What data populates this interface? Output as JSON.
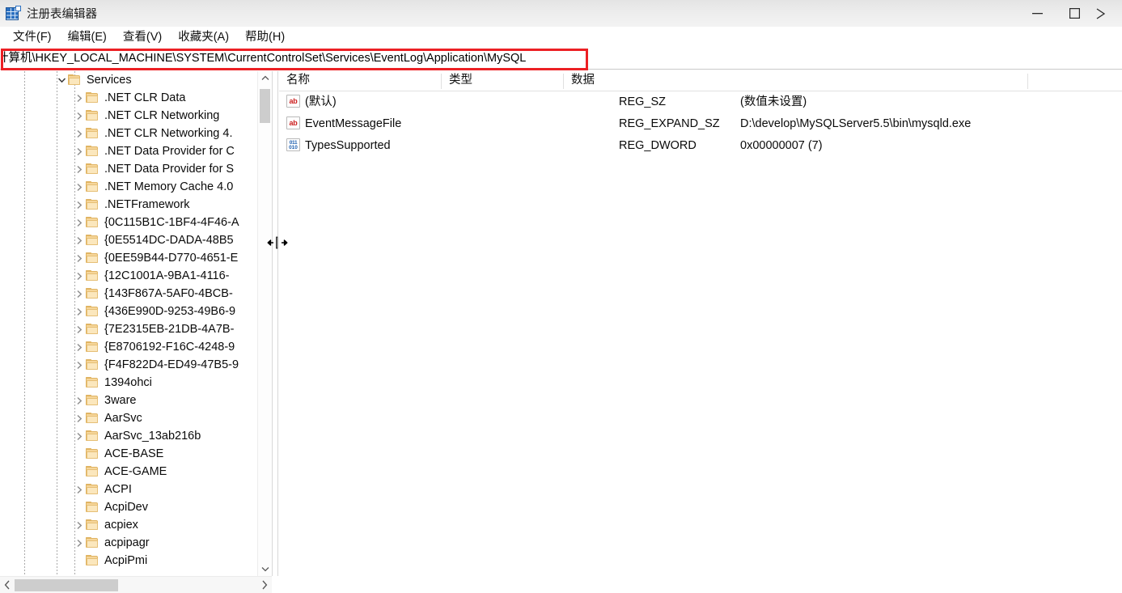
{
  "window": {
    "title": "注册表编辑器",
    "app_icon": "registry-grid-icon",
    "minimize_label": "最小化",
    "maximize_label": "最大化",
    "close_label": "关闭"
  },
  "menubar": {
    "items": [
      {
        "label": "文件(F)"
      },
      {
        "label": "编辑(E)"
      },
      {
        "label": "查看(V)"
      },
      {
        "label": "收藏夹(A)"
      },
      {
        "label": "帮助(H)"
      }
    ]
  },
  "address_bar": {
    "value": "计算机\\HKEY_LOCAL_MACHINE\\SYSTEM\\CurrentControlSet\\Services\\EventLog\\Application\\MySQL",
    "placeholder": "",
    "highlight_color": "#ec2024",
    "highlighted": true
  },
  "tree": {
    "scroll_position": "near-top",
    "items": [
      {
        "label": "Services",
        "indent": 2,
        "expander": "expanded",
        "icon": "folder-icon"
      },
      {
        "label": ".NET CLR Data",
        "indent": 3,
        "expander": "collapsed",
        "icon": "folder-icon"
      },
      {
        "label": ".NET CLR Networking",
        "indent": 3,
        "expander": "collapsed",
        "icon": "folder-icon"
      },
      {
        "label": ".NET CLR Networking 4.",
        "indent": 3,
        "expander": "collapsed",
        "icon": "folder-icon"
      },
      {
        "label": ".NET Data Provider for C",
        "indent": 3,
        "expander": "collapsed",
        "icon": "folder-icon"
      },
      {
        "label": ".NET Data Provider for S",
        "indent": 3,
        "expander": "collapsed",
        "icon": "folder-icon"
      },
      {
        "label": ".NET Memory Cache 4.0",
        "indent": 3,
        "expander": "collapsed",
        "icon": "folder-icon"
      },
      {
        "label": ".NETFramework",
        "indent": 3,
        "expander": "collapsed",
        "icon": "folder-icon"
      },
      {
        "label": "{0C115B1C-1BF4-4F46-A",
        "indent": 3,
        "expander": "collapsed",
        "icon": "folder-icon"
      },
      {
        "label": "{0E5514DC-DADA-48B5",
        "indent": 3,
        "expander": "collapsed",
        "icon": "folder-icon"
      },
      {
        "label": "{0EE59B44-D770-4651-E",
        "indent": 3,
        "expander": "collapsed",
        "icon": "folder-icon"
      },
      {
        "label": "{12C1001A-9BA1-4116-",
        "indent": 3,
        "expander": "collapsed",
        "icon": "folder-icon"
      },
      {
        "label": "{143F867A-5AF0-4BCB-",
        "indent": 3,
        "expander": "collapsed",
        "icon": "folder-icon"
      },
      {
        "label": "{436E990D-9253-49B6-9",
        "indent": 3,
        "expander": "collapsed",
        "icon": "folder-icon"
      },
      {
        "label": "{7E2315EB-21DB-4A7B-",
        "indent": 3,
        "expander": "collapsed",
        "icon": "folder-icon"
      },
      {
        "label": "{E8706192-F16C-4248-9",
        "indent": 3,
        "expander": "collapsed",
        "icon": "folder-icon"
      },
      {
        "label": "{F4F822D4-ED49-47B5-9",
        "indent": 3,
        "expander": "collapsed",
        "icon": "folder-icon"
      },
      {
        "label": "1394ohci",
        "indent": 3,
        "expander": "none",
        "icon": "folder-icon"
      },
      {
        "label": "3ware",
        "indent": 3,
        "expander": "collapsed",
        "icon": "folder-icon"
      },
      {
        "label": "AarSvc",
        "indent": 3,
        "expander": "collapsed",
        "icon": "folder-icon"
      },
      {
        "label": "AarSvc_13ab216b",
        "indent": 3,
        "expander": "collapsed",
        "icon": "folder-icon"
      },
      {
        "label": "ACE-BASE",
        "indent": 3,
        "expander": "none",
        "icon": "folder-icon"
      },
      {
        "label": "ACE-GAME",
        "indent": 3,
        "expander": "none",
        "icon": "folder-icon"
      },
      {
        "label": "ACPI",
        "indent": 3,
        "expander": "collapsed",
        "icon": "folder-icon"
      },
      {
        "label": "AcpiDev",
        "indent": 3,
        "expander": "none",
        "icon": "folder-icon"
      },
      {
        "label": "acpiex",
        "indent": 3,
        "expander": "collapsed",
        "icon": "folder-icon"
      },
      {
        "label": "acpipagr",
        "indent": 3,
        "expander": "collapsed",
        "icon": "folder-icon"
      },
      {
        "label": "AcpiPmi",
        "indent": 3,
        "expander": "none",
        "icon": "folder-icon"
      }
    ]
  },
  "value_list": {
    "columns": [
      {
        "key": "name",
        "label": "名称"
      },
      {
        "key": "type",
        "label": "类型"
      },
      {
        "key": "data",
        "label": "数据"
      }
    ],
    "rows": [
      {
        "icon": "string-value-icon",
        "name": "(默认)",
        "type": "REG_SZ",
        "data": "(数值未设置)"
      },
      {
        "icon": "string-value-icon",
        "name": "EventMessageFile",
        "type": "REG_EXPAND_SZ",
        "data": "D:\\develop\\MySQLServer5.5\\bin\\mysqld.exe"
      },
      {
        "icon": "dword-value-icon",
        "name": "TypesSupported",
        "type": "REG_DWORD",
        "data": "0x00000007 (7)"
      }
    ]
  },
  "scrollbars": {
    "tree_vertical": {
      "up_icon": "chevron-up-icon",
      "down_icon": "chevron-down-icon"
    },
    "tree_horizontal": {
      "left_icon": "chevron-left-icon",
      "right_icon": "chevron-right-icon"
    }
  }
}
